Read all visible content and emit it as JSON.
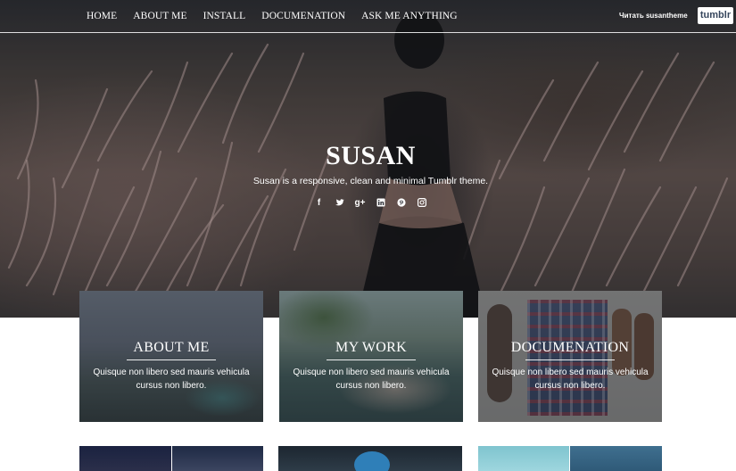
{
  "nav": {
    "links": [
      "HOME",
      "ABOUT ME",
      "INSTALL",
      "DOCUMENATION",
      "ASK ME ANYTHING"
    ],
    "follow_text": "Читать susantheme",
    "tumblr_badge": "tumblr"
  },
  "hero": {
    "title": "SUSAN",
    "description": "Susan is a responsive, clean and minimal Tumblr theme."
  },
  "socials": [
    {
      "name": "facebook-icon",
      "glyph": "f"
    },
    {
      "name": "twitter-icon",
      "glyph": ""
    },
    {
      "name": "google-plus-icon",
      "glyph": "g+"
    },
    {
      "name": "linkedin-icon",
      "glyph": "in"
    },
    {
      "name": "pinterest-icon",
      "glyph": "p"
    },
    {
      "name": "instagram-icon",
      "glyph": ""
    }
  ],
  "cards": [
    {
      "title": "ABOUT ME",
      "text": "Quisque non libero sed mauris vehicula cursus non libero."
    },
    {
      "title": "MY WORK",
      "text": "Quisque non libero sed mauris vehicula cursus non libero."
    },
    {
      "title": "DOCUMENATION",
      "text": "Quisque non libero sed mauris vehicula cursus non libero."
    }
  ],
  "colors": {
    "tumblr_blue": "#36465d",
    "text_white": "#ffffff"
  }
}
